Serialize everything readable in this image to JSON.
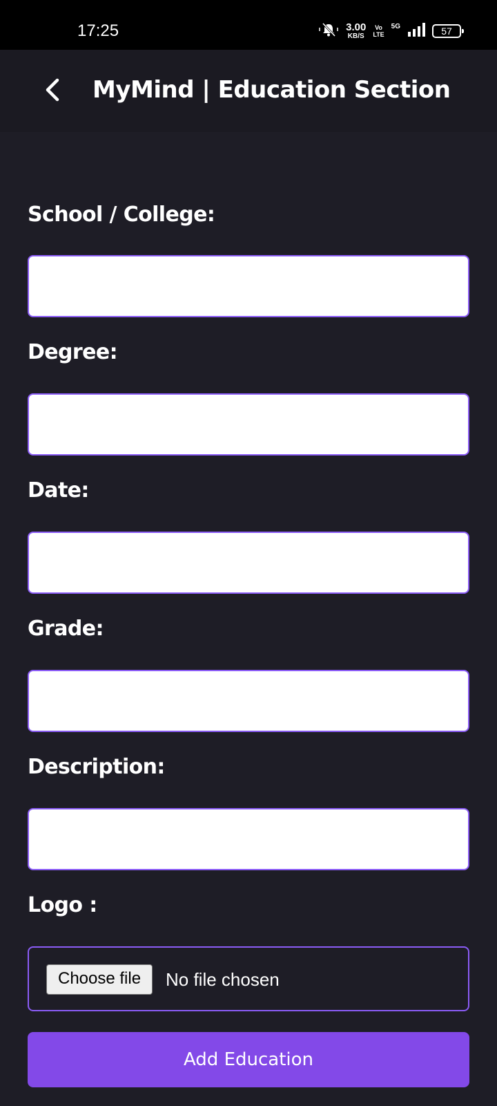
{
  "status_bar": {
    "time": "17:25",
    "net_speed_value": "3.00",
    "net_speed_unit": "KB/S",
    "volte_top": "Vo",
    "volte_bottom": "LTE",
    "network": "5G",
    "battery": "57",
    "icons": [
      "bell-muted-icon",
      "signal-icon",
      "battery-icon"
    ]
  },
  "header": {
    "title": "MyMind | Education Section",
    "back_icon": "chevron-left-icon"
  },
  "form": {
    "school_label": "School / College:",
    "degree_label": "Degree:",
    "date_label": "Date:",
    "grade_label": "Grade:",
    "description_label": "Description:",
    "logo_label": "Logo :",
    "school_value": "",
    "degree_value": "",
    "date_value": "",
    "grade_value": "",
    "description_value": "",
    "file_button_label": "Choose file",
    "file_status": "No file chosen",
    "submit_label": "Add Education"
  },
  "colors": {
    "background": "#1e1d26",
    "header_background": "#1b1a22",
    "accent": "#8349e8",
    "input_border": "#8b5cf6"
  }
}
